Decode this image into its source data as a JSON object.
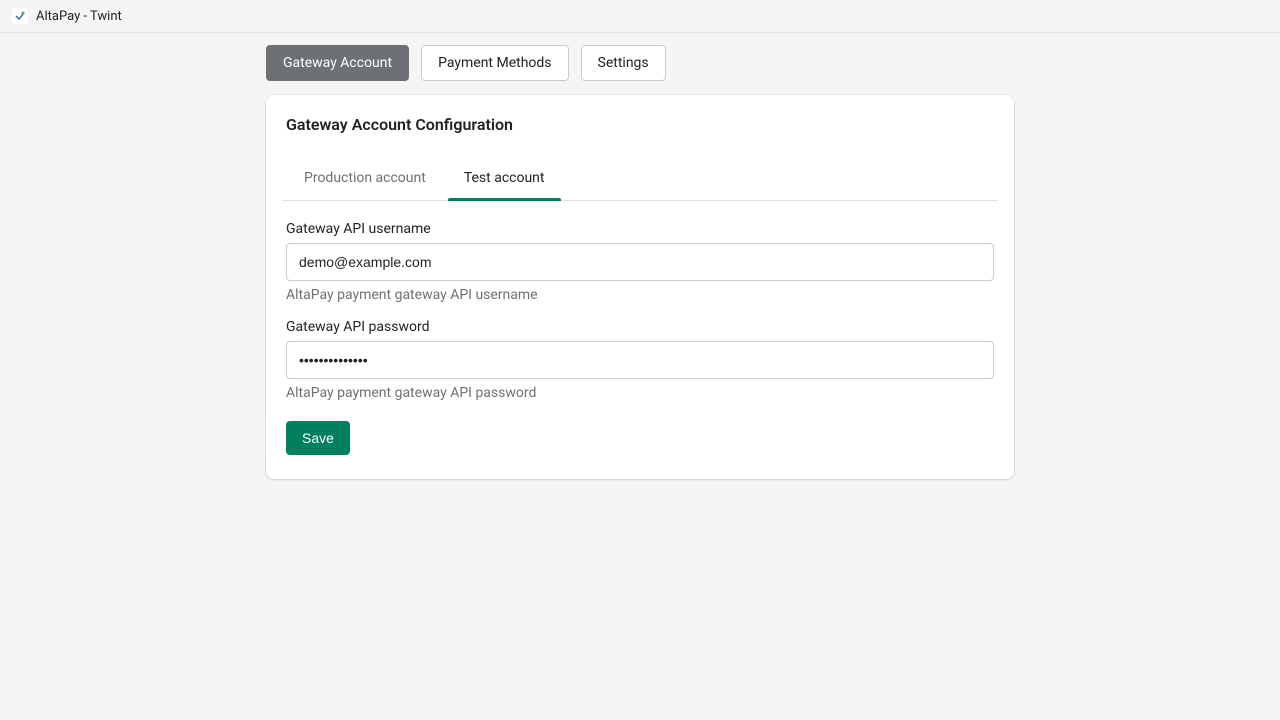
{
  "header": {
    "app_title": "AltaPay - Twint"
  },
  "nav": {
    "tabs": [
      {
        "label": "Gateway Account",
        "active": true
      },
      {
        "label": "Payment Methods",
        "active": false
      },
      {
        "label": "Settings",
        "active": false
      }
    ]
  },
  "card": {
    "title": "Gateway Account Configuration",
    "sub_tabs": [
      {
        "label": "Production account",
        "active": false
      },
      {
        "label": "Test account",
        "active": true
      }
    ],
    "form": {
      "username": {
        "label": "Gateway API username",
        "value": "demo@example.com",
        "help": "AltaPay payment gateway API username"
      },
      "password": {
        "label": "Gateway API password",
        "value": "••••••••••••••",
        "help": "AltaPay payment gateway API password"
      },
      "save_label": "Save"
    }
  }
}
